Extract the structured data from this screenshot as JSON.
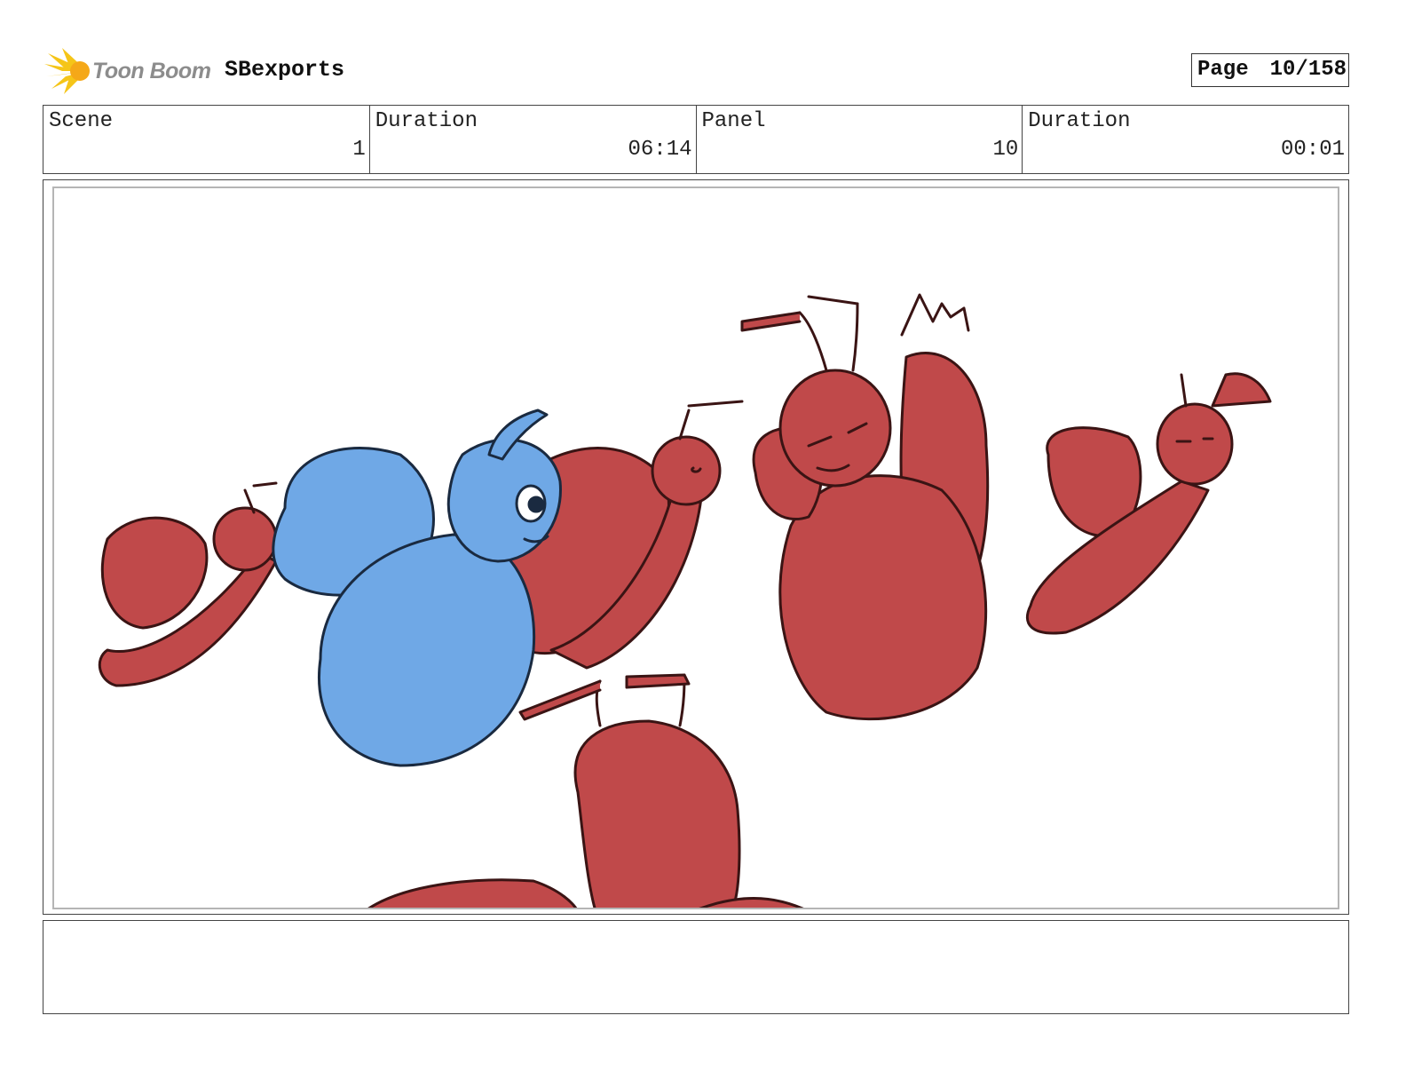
{
  "header": {
    "logo_text": "Toon Boom",
    "project_name": "SBexports",
    "page_label": "Page",
    "page_value": "10/158"
  },
  "info": {
    "scene_label": "Scene",
    "scene_value": "1",
    "scene_duration_label": "Duration",
    "scene_duration_value": "06:14",
    "panel_label": "Panel",
    "panel_value": "10",
    "panel_duration_label": "Duration",
    "panel_duration_value": "00:01"
  },
  "colors": {
    "red_character": "#c0494a",
    "blue_character": "#6fa8e6",
    "outline": "#3a1414",
    "logo_yellow": "#f5c518"
  },
  "icons": {
    "logo": "toon-boom-starburst-icon"
  },
  "notes": {
    "text": ""
  }
}
